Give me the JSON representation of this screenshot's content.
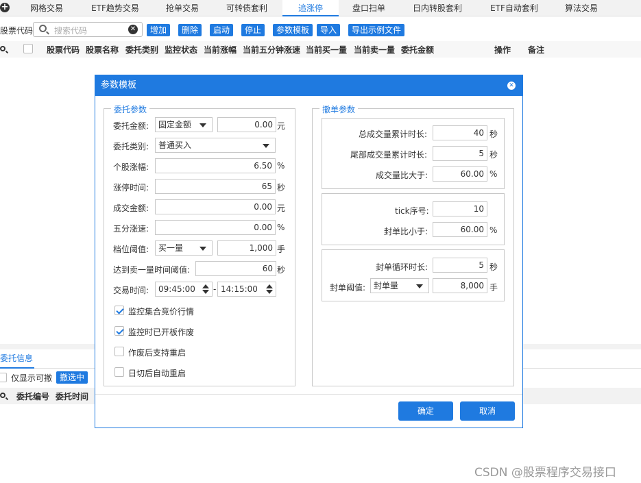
{
  "tabs": [
    {
      "label": "网格交易",
      "active": false
    },
    {
      "label": "ETF趋势交易",
      "active": false
    },
    {
      "label": "抢单交易",
      "active": false
    },
    {
      "label": "可转债套利",
      "active": false
    },
    {
      "label": "追涨停",
      "active": true
    },
    {
      "label": "盘口扫单",
      "active": false
    },
    {
      "label": "日内转股套利",
      "active": false
    },
    {
      "label": "ETF自动套利",
      "active": false
    },
    {
      "label": "算法交易",
      "active": false
    }
  ],
  "toolbar": {
    "stock_code_label": "股票代码",
    "search_placeholder": "搜索代码",
    "buttons": [
      "增加",
      "删除",
      "启动",
      "停止",
      "参数模板",
      "导入",
      "导出示例文件"
    ]
  },
  "table": {
    "headers": [
      "股票代码",
      "股票名称",
      "委托类别",
      "监控状态",
      "当前涨幅",
      "当前五分钟涨速",
      "当前买一量",
      "当前卖一量",
      "委托金额",
      "操作",
      "备注"
    ]
  },
  "bottom": {
    "tab_label": "委托信息",
    "only_show_label": "仅显示可撤",
    "cancel_button": "撤选中",
    "headers": [
      "委托编号",
      "委托时间"
    ]
  },
  "dialog": {
    "title": "参数模板",
    "left_group": "委托参数",
    "right_group": "撤单参数",
    "fields": {
      "amount_label": "委托金额:",
      "amount_mode": "固定金额",
      "amount_value": "0.00",
      "amount_unit": "元",
      "category_label": "委托类别:",
      "category_value": "普通买入",
      "gain_label": "个股涨幅:",
      "gain_value": "6.50",
      "gain_unit": "%",
      "limit_time_label": "涨停时间:",
      "limit_time_value": "65",
      "limit_time_unit": "秒",
      "turnover_label": "成交金额:",
      "turnover_value": "0.00",
      "turnover_unit": "元",
      "speed5_label": "五分涨速:",
      "speed5_value": "0.00",
      "speed5_unit": "%",
      "level_label": "档位阈值:",
      "level_mode": "买一量",
      "level_value": "1,000",
      "level_unit": "手",
      "sell1_label": "达到卖一量时间阈值:",
      "sell1_value": "60",
      "sell1_unit": "秒",
      "trade_time_label": "交易时间:",
      "trade_time_start": "09:45:00",
      "trade_time_sep": "-",
      "trade_time_end": "14:15:00"
    },
    "checkboxes": [
      {
        "label": "监控集合竞价行情",
        "checked": true
      },
      {
        "label": "监控时已开板作废",
        "checked": true
      },
      {
        "label": "作废后支持重启",
        "checked": false
      },
      {
        "label": "日切后自动重启",
        "checked": false
      }
    ],
    "cancel_params": {
      "total_vol_time_label": "总成交量累计时长:",
      "total_vol_time_value": "40",
      "total_vol_time_unit": "秒",
      "tail_vol_time_label": "尾部成交量累计时长:",
      "tail_vol_time_value": "5",
      "tail_vol_time_unit": "秒",
      "vol_ratio_label": "成交量比大于:",
      "vol_ratio_value": "60.00",
      "vol_ratio_unit": "%",
      "tick_label": "tick序号:",
      "tick_value": "10",
      "seal_ratio_label": "封单比小于:",
      "seal_ratio_value": "60.00",
      "seal_ratio_unit": "%",
      "seal_cycle_label": "封单循环时长:",
      "seal_cycle_value": "5",
      "seal_cycle_unit": "秒",
      "seal_threshold_label": "封单阈值:",
      "seal_threshold_mode": "封单量",
      "seal_threshold_value": "8,000",
      "seal_threshold_unit": "手"
    },
    "ok_label": "确定",
    "cancel_label": "取消"
  },
  "watermark": "CSDN @股票程序交易接口",
  "colors": {
    "accent": "#1f7ae0"
  }
}
